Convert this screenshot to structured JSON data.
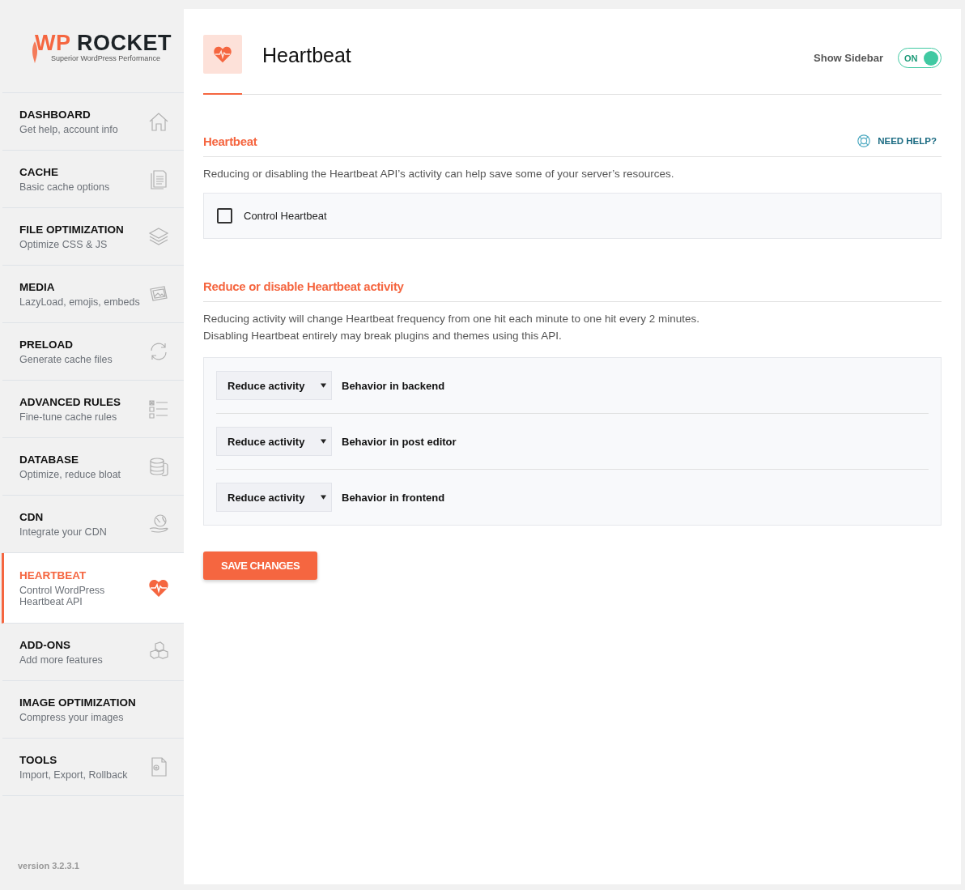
{
  "logo": {
    "brand_first": "WP",
    "brand_second": "ROCKET",
    "tagline": "Superior WordPress Performance"
  },
  "sidebar": {
    "items": [
      {
        "title": "DASHBOARD",
        "subtitle": "Get help, account info",
        "selected": false
      },
      {
        "title": "CACHE",
        "subtitle": "Basic cache options",
        "selected": false
      },
      {
        "title": "FILE OPTIMIZATION",
        "subtitle": "Optimize CSS & JS",
        "selected": false
      },
      {
        "title": "MEDIA",
        "subtitle": "LazyLoad, emojis, embeds",
        "selected": false
      },
      {
        "title": "PRELOAD",
        "subtitle": "Generate cache files",
        "selected": false
      },
      {
        "title": "ADVANCED RULES",
        "subtitle": "Fine-tune cache rules",
        "selected": false
      },
      {
        "title": "DATABASE",
        "subtitle": "Optimize, reduce bloat",
        "selected": false
      },
      {
        "title": "CDN",
        "subtitle": "Integrate your CDN",
        "selected": false
      },
      {
        "title": "HEARTBEAT",
        "subtitle": "Control WordPress Heartbeat API",
        "selected": true
      },
      {
        "title": "ADD-ONS",
        "subtitle": "Add more features",
        "selected": false
      },
      {
        "title": "IMAGE OPTIMIZATION",
        "subtitle": "Compress your images",
        "selected": false
      },
      {
        "title": "TOOLS",
        "subtitle": "Import, Export, Rollback",
        "selected": false
      }
    ],
    "version": "version 3.2.3.1"
  },
  "header": {
    "title": "Heartbeat",
    "sidebar_toggle": {
      "label": "Show Sidebar",
      "on": true,
      "state_text": "ON"
    }
  },
  "section1": {
    "title": "Heartbeat",
    "help_link": "NEED HELP?",
    "description": "Reducing or disabling the Heartbeat API’s activity can help save some of your server’s resources.",
    "checkbox": {
      "label": "Control Heartbeat",
      "checked": false
    }
  },
  "section2": {
    "title": "Reduce or disable Heartbeat activity",
    "description": [
      "Reducing activity will change Heartbeat frequency from one hit each minute to one hit every 2 minutes.",
      "Disabling Heartbeat entirely may break plugins and themes using this API."
    ],
    "settings": [
      {
        "value": "Reduce activity",
        "label": "Behavior in backend"
      },
      {
        "value": "Reduce activity",
        "label": "Behavior in post editor"
      },
      {
        "value": "Reduce activity",
        "label": "Behavior in frontend"
      }
    ]
  },
  "save_button": "SAVE CHANGES"
}
